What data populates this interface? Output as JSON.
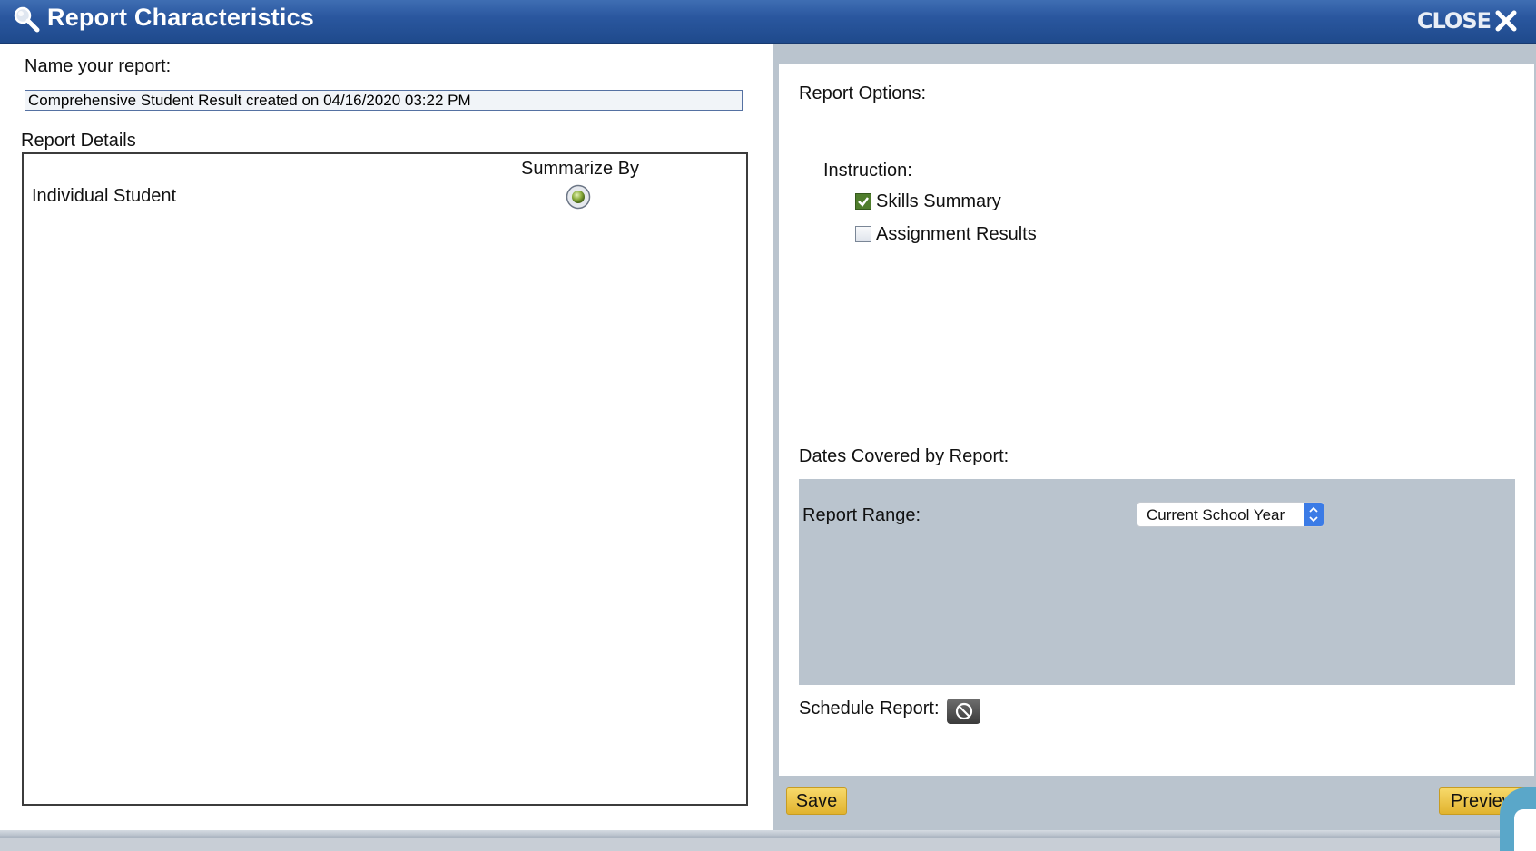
{
  "window": {
    "title": "Report Characteristics",
    "close_label": "CLOSE"
  },
  "left": {
    "name_label": "Name your report:",
    "name_value": "Comprehensive Student Result created on 04/16/2020 03:22 PM",
    "details_label": "Report Details",
    "summarize_header": "Summarize By",
    "rows": [
      {
        "label": "Individual Student",
        "selected": true
      }
    ]
  },
  "right": {
    "options_label": "Report Options:",
    "instruction_label": "Instruction:",
    "instruction_options": [
      {
        "label": "Skills Summary",
        "checked": true
      },
      {
        "label": "Assignment Results",
        "checked": false
      }
    ],
    "dates_label": "Dates Covered by Report:",
    "range_label": "Report Range:",
    "range_value": "Current School Year",
    "schedule_label": "Schedule Report:"
  },
  "footer": {
    "save_label": "Save",
    "preview_label": "Preview"
  },
  "colors": {
    "titlebar": "#2a579f",
    "panel_gray": "#bac4ce",
    "button_yellow": "#e9c243",
    "checkbox_green": "#4f7d2c"
  },
  "icons": [
    "magnifier-icon",
    "close-x-icon",
    "radio-selected-icon",
    "checkbox-checked-icon",
    "select-arrows-icon",
    "no-schedule-icon"
  ]
}
